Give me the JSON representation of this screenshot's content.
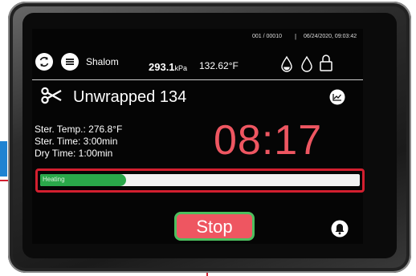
{
  "header": {
    "counter": "001 / 00010",
    "separator": "|",
    "datetime": "06/24/2020, 09:03:42",
    "user_name": "Shalom",
    "pressure_value": "293.1",
    "pressure_unit": "kPa",
    "temperature": "132.62°F",
    "icons": [
      "refresh-icon",
      "menu-icon",
      "water-drop-filled-icon",
      "water-drop-outline-icon",
      "lock-icon"
    ]
  },
  "program": {
    "name": "Unwrapped 134",
    "icon": "scissors-icon",
    "chart_icon": "chart-icon"
  },
  "params": {
    "ster_temp": "Ster. Temp.: 276.8°F",
    "ster_time": "Ster. Time: 3:00min",
    "dry_time": "Dry Time: 1:00min"
  },
  "timer": {
    "value": "08:17"
  },
  "progress": {
    "label": "Heating",
    "fraction": 0.27
  },
  "actions": {
    "stop_label": "Stop",
    "bell_icon": "bell-icon"
  },
  "colors": {
    "accent_red": "#ee5661",
    "progress_green": "#2aa84a",
    "callout_red": "#d31f2f",
    "stop_outline": "#4cbf5e"
  }
}
